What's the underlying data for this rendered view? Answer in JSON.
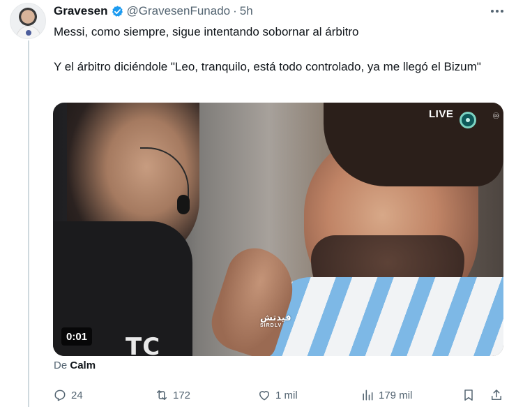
{
  "tweet": {
    "display_name": "Gravesen",
    "handle": "@GravesenFunado",
    "separator": "·",
    "time": "5h",
    "text_line1": "Messi, como siempre, sigue intentando sobornar al árbitro",
    "text_line2": "Y el árbitro diciéndole \"Leo, tranquilo, está todo controlado, ya me llegó el Bizum\"",
    "verified_color": "#1d9bf0"
  },
  "video": {
    "live_label": "LIVE",
    "watermark": "فيدتش",
    "watermark_sub": "SIRDLV",
    "ref_shirt_text": "TC",
    "duration": "0:01"
  },
  "attribution": {
    "prefix": "De",
    "source": "Calm"
  },
  "actions": {
    "replies": "24",
    "retweets": "172",
    "likes": "1 mil",
    "views": "179 mil"
  },
  "icons": [
    "verified-badge-icon",
    "more-icon",
    "reply-icon",
    "retweet-icon",
    "like-icon",
    "views-icon",
    "bookmark-icon",
    "share-icon"
  ]
}
